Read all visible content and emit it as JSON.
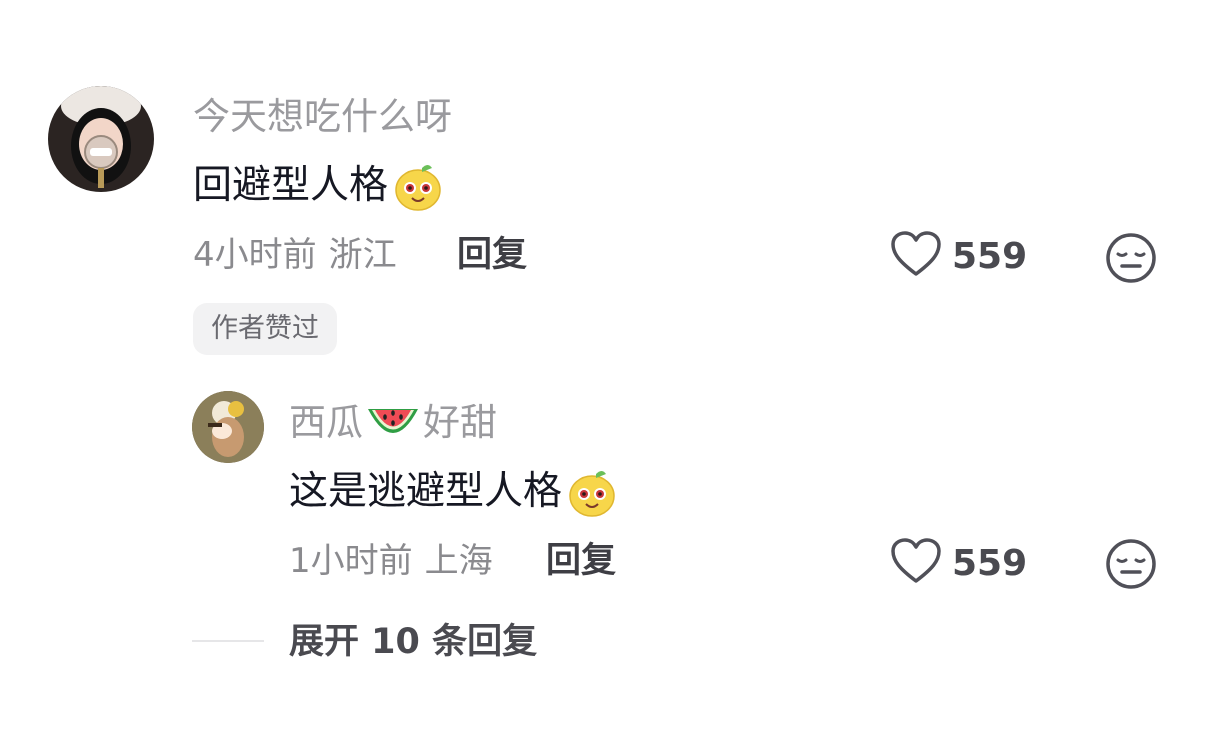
{
  "comment": {
    "username": "今天想吃什么呀",
    "text": "回避型人格",
    "time": "4小时前",
    "location": "浙江",
    "reply_label": "回复",
    "like_count": "559",
    "author_liked_badge": "作者赞过"
  },
  "reply": {
    "username_part1": "西瓜",
    "username_part2": "好甜",
    "text": "这是逃避型人格",
    "time": "1小时前",
    "location": "上海",
    "reply_label": "回复",
    "like_count": "559"
  },
  "expand": {
    "label": "展开 10 条回复"
  },
  "colors": {
    "username": "#9a9a9e",
    "content": "#161823",
    "meta": "#8a8a8e",
    "icon_stroke": "#505058",
    "badge_bg": "#f2f2f3",
    "emoji_yellow": "#f7d64a"
  },
  "icons": {
    "like": "heart-outline-icon",
    "dislike": "meh-face-icon",
    "comment_emoji": "yellow-bear-emoji-icon",
    "watermelon": "watermelon-emoji-icon"
  }
}
